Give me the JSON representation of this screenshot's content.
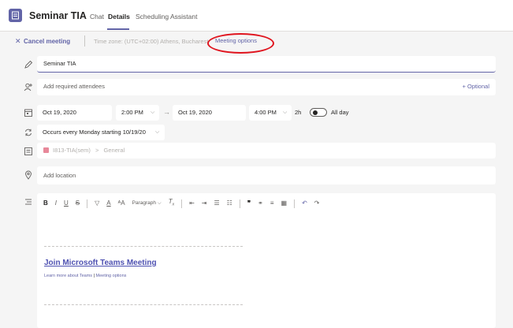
{
  "header": {
    "title": "Seminar TIA",
    "tabs": [
      {
        "label": "Chat",
        "active": false
      },
      {
        "label": "Details",
        "active": true
      },
      {
        "label": "Scheduling Assistant",
        "active": false
      }
    ]
  },
  "subbar": {
    "cancel_label": "Cancel meeting",
    "timezone": "Time zone: (UTC+02:00) Athens, Bucharest",
    "options_label": "Meeting options"
  },
  "form": {
    "title_value": "Seminar TIA",
    "attendees_placeholder": "Add required attendees",
    "optional_label": "+ Optional",
    "start_date": "Oct 19, 2020",
    "start_time": "2:00 PM",
    "end_date": "Oct 19, 2020",
    "end_time": "4:00 PM",
    "duration": "2h",
    "allday_label": "All day",
    "allday_on": false,
    "recurrence": "Occurs every Monday starting 10/19/20",
    "channel_team": "I813-TIA(sem)",
    "channel_separator": ">",
    "channel_name": "General",
    "location_placeholder": "Add location"
  },
  "editor": {
    "toolbar": [
      "B",
      "I",
      "U",
      "S",
      "Paragraph"
    ],
    "join_link": "Join Microsoft Teams Meeting",
    "learn_more": "Learn more about Teams",
    "learn_separator": "|",
    "meeting_options_link": "Meeting options"
  },
  "colors": {
    "accent": "#6264a7",
    "highlight_ring": "#e0141e",
    "link": "#4f52b2"
  }
}
